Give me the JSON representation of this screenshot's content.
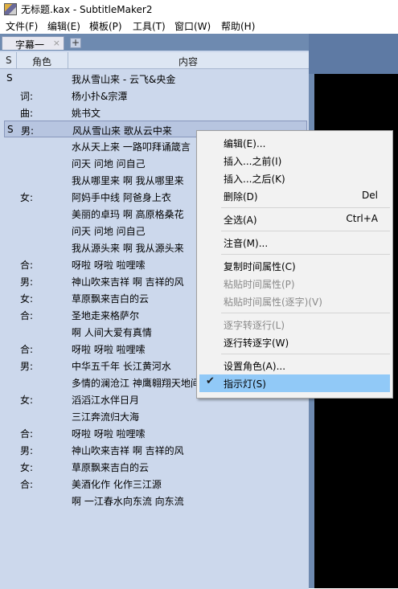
{
  "window": {
    "title": "无标题.kax - SubtitleMaker2"
  },
  "menubar": [
    "文件(F)",
    "编辑(E)",
    "模板(P)",
    "工具(T)",
    "窗口(W)",
    "帮助(H)"
  ],
  "tab": {
    "label": "字幕一",
    "close": "×",
    "add": "+"
  },
  "columns": {
    "s": "S",
    "role": "角色",
    "content": "内容"
  },
  "rows": [
    {
      "s": "S",
      "role": "",
      "text": "我从雪山来 - 云飞&央金"
    },
    {
      "s": "",
      "role": "词:",
      "text": "杨小扑&宗潭"
    },
    {
      "s": "",
      "role": "曲:",
      "text": "姚书文"
    },
    {
      "s": "S",
      "role": "男:",
      "text": "风从雪山来 歌从云中来",
      "selected": true
    },
    {
      "s": "",
      "role": "",
      "text": "水从天上来 一路叩拜诵箴言"
    },
    {
      "s": "",
      "role": "",
      "text": "问天 问地 问自己"
    },
    {
      "s": "",
      "role": "",
      "text": "我从哪里来 啊 我从哪里来"
    },
    {
      "s": "",
      "role": "女:",
      "text": "阿妈手中线 阿爸身上衣"
    },
    {
      "s": "",
      "role": "",
      "text": "美丽的卓玛 啊 高原格桑花"
    },
    {
      "s": "",
      "role": "",
      "text": "问天 问地 问自己"
    },
    {
      "s": "",
      "role": "",
      "text": "我从源头来 啊 我从源头来"
    },
    {
      "s": "",
      "role": "合:",
      "text": "呀啦 呀啦 啦哩嗦"
    },
    {
      "s": "",
      "role": "男:",
      "text": "神山吹来吉祥 啊 吉祥的风"
    },
    {
      "s": "",
      "role": "女:",
      "text": "草原飘来吉白的云"
    },
    {
      "s": "",
      "role": "合:",
      "text": "圣地走来格萨尔"
    },
    {
      "s": "",
      "role": "",
      "text": "啊 人间大爱有真情"
    },
    {
      "s": "",
      "role": "合:",
      "text": "呀啦 呀啦 啦哩嗦"
    },
    {
      "s": "",
      "role": "男:",
      "text": "中华五千年 长江黄河水"
    },
    {
      "s": "",
      "role": "",
      "text": "多情的澜沧江 神鹰翱翔天地间"
    },
    {
      "s": "",
      "role": "女:",
      "text": "滔滔江水伴日月"
    },
    {
      "s": "",
      "role": "",
      "text": "三江奔流归大海"
    },
    {
      "s": "",
      "role": "合:",
      "text": "呀啦 呀啦 啦哩嗦"
    },
    {
      "s": "",
      "role": "男:",
      "text": "神山吹来吉祥 啊 吉祥的风"
    },
    {
      "s": "",
      "role": "女:",
      "text": "草原飘来吉白的云"
    },
    {
      "s": "",
      "role": "合:",
      "text": "美酒化作 化作三江源"
    },
    {
      "s": "",
      "role": "",
      "text": "啊 一江春水向东流 向东流"
    }
  ],
  "context_menu": [
    {
      "label": "编辑(E)..."
    },
    {
      "label": "插入...之前(I)"
    },
    {
      "label": "插入...之后(K)"
    },
    {
      "label": "删除(D)",
      "shortcut": "Del"
    },
    {
      "sep": true
    },
    {
      "label": "全选(A)",
      "shortcut": "Ctrl+A"
    },
    {
      "sep": true
    },
    {
      "label": "注音(M)..."
    },
    {
      "sep": true
    },
    {
      "label": "复制时间属性(C)"
    },
    {
      "label": "粘贴时间属性(P)",
      "disabled": true
    },
    {
      "label": "粘贴时间属性(逐字)(V)",
      "disabled": true
    },
    {
      "sep": true
    },
    {
      "label": "逐字转逐行(L)",
      "disabled": true
    },
    {
      "label": "逐行转逐字(W)"
    },
    {
      "sep": true
    },
    {
      "label": "设置角色(A)..."
    },
    {
      "label": "指示灯(S)",
      "checked": true,
      "highlighted": true
    }
  ]
}
